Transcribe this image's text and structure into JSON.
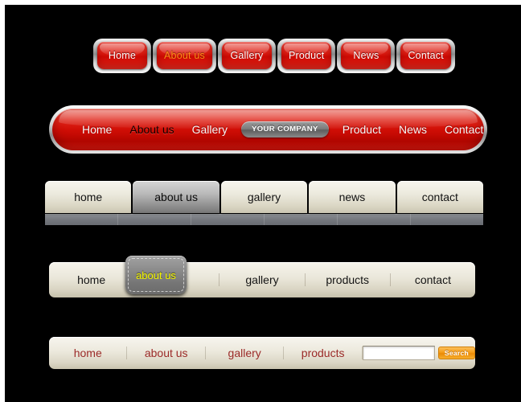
{
  "canvas": {
    "background": "#000000"
  },
  "navbars": [
    {
      "id": "red-chrome-buttons",
      "style": "chrome-framed-red-buttons",
      "items": [
        {
          "label": "Home",
          "state": "normal",
          "color": "#ffffff"
        },
        {
          "label": "About us",
          "state": "hover",
          "color": "#ff8a18"
        },
        {
          "label": "Gallery",
          "state": "normal",
          "color": "#ffffff"
        },
        {
          "label": "Product",
          "state": "normal",
          "color": "#ffffff"
        },
        {
          "label": "News",
          "state": "normal",
          "color": "#ffffff"
        },
        {
          "label": "Contact",
          "state": "normal",
          "color": "#ffffff"
        }
      ]
    },
    {
      "id": "red-glossy-bar",
      "style": "glossy-red-pill-bar",
      "accent": "#cf0d05",
      "items": [
        {
          "label": "Home",
          "state": "normal",
          "color": "#f7f7f7"
        },
        {
          "label": "About us",
          "state": "hover",
          "color": "#120000"
        },
        {
          "label": "Gallery",
          "state": "normal",
          "color": "#f7f7f7"
        },
        {
          "label": "Product",
          "state": "normal",
          "color": "#f7f7f7"
        },
        {
          "label": "News",
          "state": "normal",
          "color": "#f7f7f7"
        },
        {
          "label": "Contact",
          "state": "normal",
          "color": "#f7f7f7"
        }
      ],
      "brand": {
        "label": "YOUR COMPANY",
        "color": "#ffffff",
        "background": "#7d7d7d"
      }
    },
    {
      "id": "cream-tabs-bar",
      "style": "cream-tabs-with-grey-strip",
      "items": [
        {
          "label": "home",
          "state": "normal"
        },
        {
          "label": "about us",
          "state": "active"
        },
        {
          "label": "gallery",
          "state": "normal"
        },
        {
          "label": "news",
          "state": "normal"
        },
        {
          "label": "contact",
          "state": "normal"
        }
      ],
      "strip_color": "#74777d",
      "strip_segments": 6
    },
    {
      "id": "cream-bar-raised-tab",
      "style": "cream-bar-with-raised-grey-tab",
      "items": [
        {
          "label": "home",
          "state": "normal"
        },
        {
          "label": "about us",
          "state": "active"
        },
        {
          "label": "gallery",
          "state": "normal"
        },
        {
          "label": "products",
          "state": "normal"
        },
        {
          "label": "contact",
          "state": "normal"
        }
      ],
      "active_text_color": "#f3f500",
      "active_tab_color": "#8d8d8d"
    },
    {
      "id": "cream-bar-search",
      "style": "cream-bar-with-search",
      "text_color": "#9b2a28",
      "items": [
        {
          "label": "home"
        },
        {
          "label": "about us"
        },
        {
          "label": "gallery"
        },
        {
          "label": "products"
        }
      ],
      "search": {
        "value": "",
        "placeholder": "",
        "button_label": "Search",
        "button_color": "#f59d17"
      }
    }
  ]
}
